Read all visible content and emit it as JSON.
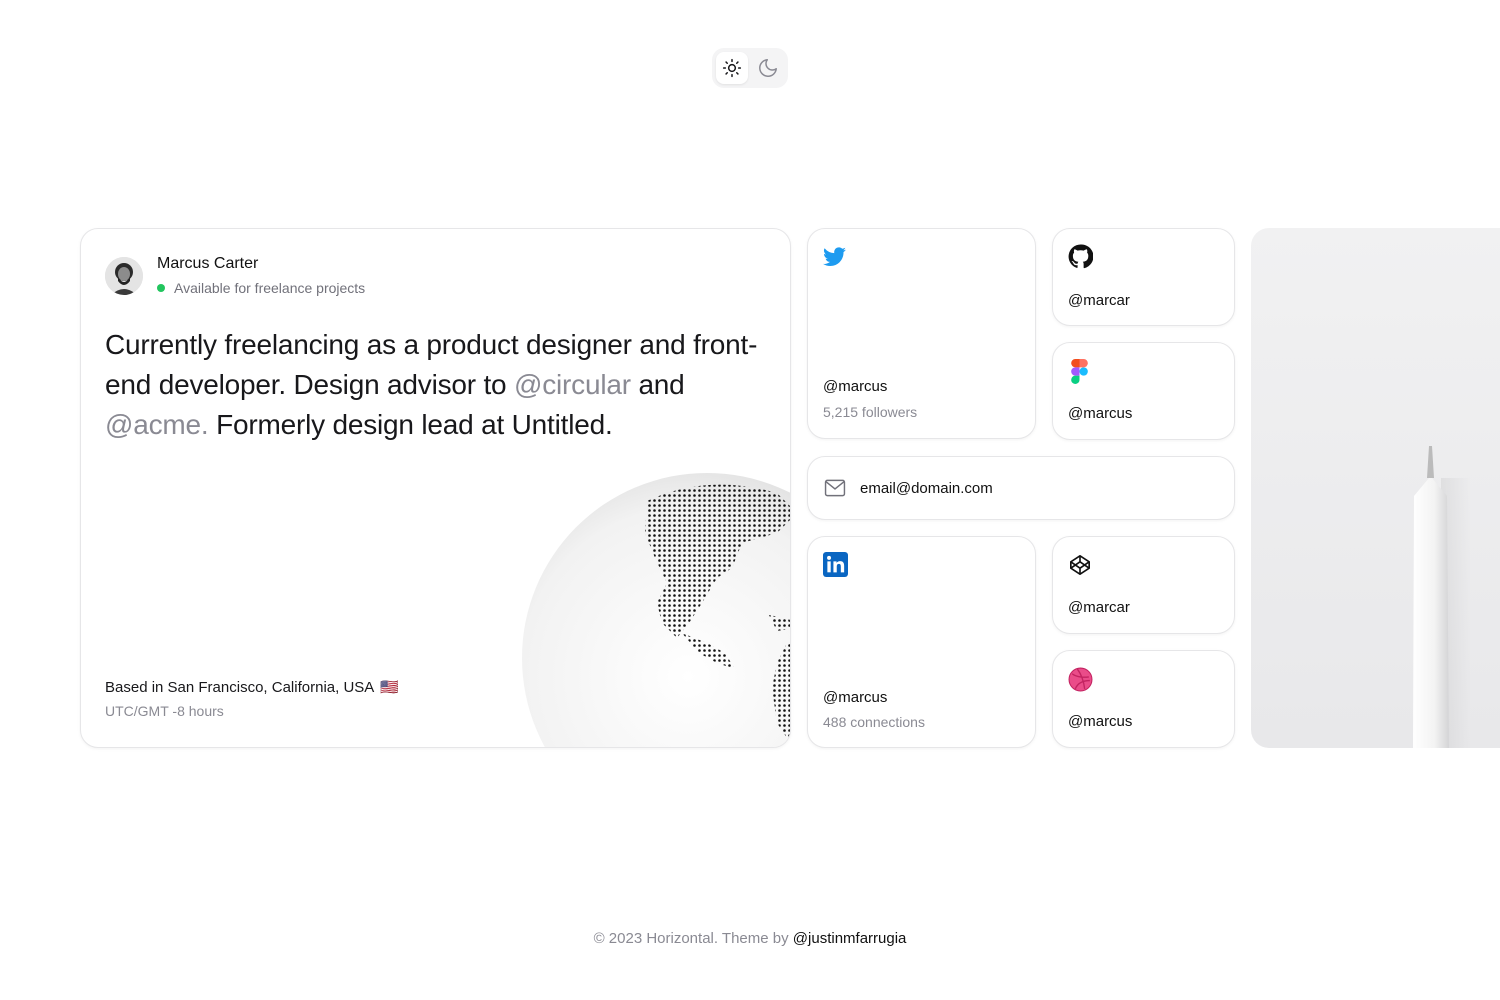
{
  "theme_toggle": {
    "light_icon": "sun-icon",
    "dark_icon": "moon-icon",
    "active": "light"
  },
  "profile": {
    "name": "Marcus Carter",
    "status": "Available for freelance projects",
    "status_color": "#22c55e",
    "bio_part1": "Currently freelancing as a product designer and front-end developer. Design advisor to ",
    "mention1": "@circular",
    "bio_part2": " and ",
    "mention2": "@acme.",
    "bio_part3": " Formerly design lead at Untitled.",
    "location": "Based in San Francisco, California, USA",
    "flag": "🇺🇸",
    "timezone": "UTC/GMT -8 hours"
  },
  "social": {
    "twitter": {
      "icon": "twitter-icon",
      "handle": "@marcus",
      "followers": "5,215 followers",
      "color": "#1d9bf0"
    },
    "github": {
      "icon": "github-icon",
      "handle": "@marcar"
    },
    "figma": {
      "icon": "figma-icon",
      "handle": "@marcus"
    },
    "email": {
      "icon": "mail-icon",
      "address": "email@domain.com"
    },
    "linkedin": {
      "icon": "linkedin-icon",
      "handle": "@marcus",
      "connections": "488 connections",
      "color": "#0a66c2"
    },
    "codepen": {
      "icon": "codepen-icon",
      "handle": "@marcar"
    },
    "dribbble": {
      "icon": "dribbble-icon",
      "handle": "@marcus",
      "color": "#ea4c89"
    }
  },
  "footer": {
    "text": "© 2023 Horizontal. Theme by ",
    "link": "@justinmfarrugia"
  }
}
